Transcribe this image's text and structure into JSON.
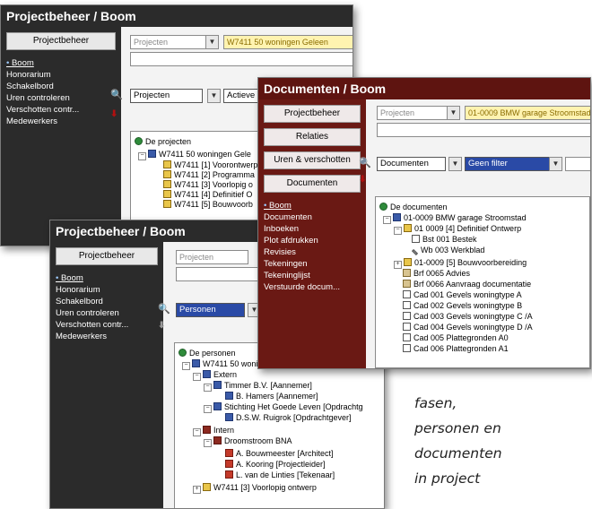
{
  "win1": {
    "title": "Projectbeheer / Boom",
    "side_header": "Projectbeheer",
    "nav": [
      "Boom",
      "Honorarium",
      "Schakelbord",
      "Uren controleren",
      "Verschotten contr...",
      "Medewerkers"
    ],
    "combo_top": "Projecten",
    "project_field": "W7411 50 woningen  Geleen",
    "filter_combo": "Projecten",
    "filter2": "Actieve p",
    "tree": [
      "De projecten",
      "W7411 50 woningen  Gele",
      "W7411 [1] Voorontwerp",
      "W7411 [2] Programma",
      "W7411 [3] Voorlopig o",
      "W7411 [4] Definitief O",
      "W7411 [5] Bouwvoorb"
    ]
  },
  "win2": {
    "title": "Documenten / Boom",
    "side_headers": [
      "Projectbeheer",
      "Relaties",
      "Uren & verschotten",
      "Documenten"
    ],
    "nav": [
      "Boom",
      "Documenten",
      "Inboeken",
      "Plot afdrukken",
      "Revisies",
      "Tekeningen",
      "Tekeninglijst",
      "Verstuurde docum..."
    ],
    "combo_top": "Projecten",
    "project_field": "01-0009 BMW garage  Stroomstad",
    "filter_combo": "Documenten",
    "filter2": "Geen filter",
    "tree": [
      "De documenten",
      "01-0009 BMW garage  Stroomstad",
      "01 0009 [4] Definitief Ontwerp",
      "Bst 001 Bestek",
      "Wb 003 Werkblad",
      "01-0009 [5] Bouwvoorbereiding",
      "Brf 0065 Advies",
      "Brf 0066 Aanvraag documentatie",
      "Cad 001 Gevels woningtype A",
      "Cad 002 Gevels woningtype B",
      "Cad 003 Gevels woningtype C  /A",
      "Cad 004 Gevels woningtype D  /A",
      "Cad 005 Plattegronden A0",
      "Cad 006 Plattegronden A1"
    ]
  },
  "win3": {
    "title": "Projectbeheer / Boom",
    "side_header": "Projectbeheer",
    "nav": [
      "Boom",
      "Honorarium",
      "Schakelbord",
      "Uren controleren",
      "Verschotten contr...",
      "Medewerkers"
    ],
    "combo_top": "Projecten",
    "filter_combo": "Personen",
    "tree": [
      "De personen",
      "W7411 50 woningen  Geleen",
      "Extern",
      "Timmer B.V. [Aannemer]",
      "B. Hamers [Aannemer]",
      "Stichting Het Goede Leven [Opdrachtg",
      "D.S.W. Ruigrok [Opdrachtgever]",
      "Intern",
      "Droomstroom BNA",
      "A. Bouwmeester [Architect]",
      "A. Kooring [Projectleider]",
      "L. van de Linties [Tekenaar]",
      "W7411 [3] Voorlopig ontwerp"
    ]
  },
  "caption": [
    "fasen,",
    "personen en",
    "documenten",
    "in project"
  ],
  "colors": {
    "dark_title": "#2b2b2b",
    "red_title": "#5e1410",
    "red_sidebar": "#6a1914",
    "highlight": "#fff3b0"
  },
  "icons": [
    "binoculars-icon",
    "tree-root-icon",
    "folder-icon",
    "document-icon",
    "person-icon",
    "group-icon",
    "pen-icon"
  ]
}
